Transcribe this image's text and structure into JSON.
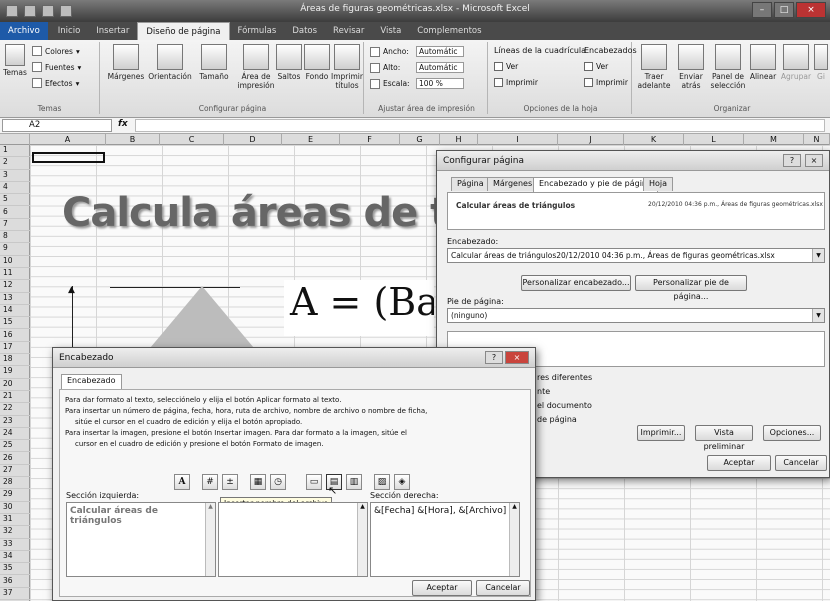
{
  "window": {
    "title": "Áreas de figuras geométricas.xlsx - Microsoft Excel"
  },
  "tabs": [
    "Archivo",
    "Inicio",
    "Insertar",
    "Diseño de página",
    "Fórmulas",
    "Datos",
    "Revisar",
    "Vista",
    "Complementos"
  ],
  "ribbon": {
    "temas": {
      "big": "Temas",
      "colores": "Colores",
      "fuentes": "Fuentes",
      "efectos": "Efectos",
      "label": "Temas"
    },
    "config": {
      "margenes": "Márgenes",
      "orientacion": "Orientación",
      "tamano": "Tamaño",
      "area": "Área de impresión",
      "saltos": "Saltos",
      "fondo": "Fondo",
      "imprimir_titulos": "Imprimir títulos",
      "label": "Configurar página"
    },
    "ajustar": {
      "ancho": "Ancho:",
      "ancho_val": "Automátic",
      "alto": "Alto:",
      "alto_val": "Automátic",
      "escala": "Escala:",
      "escala_val": "100 %",
      "label": "Ajustar área de impresión"
    },
    "opciones": {
      "lineas": "Líneas de la cuadrícula",
      "encabezados": "Encabezados",
      "ver": "Ver",
      "imprimir": "Imprimir",
      "label": "Opciones de la hoja"
    },
    "organizar": {
      "traer": "Traer adelante",
      "enviar": "Enviar atrás",
      "panel": "Panel de selección",
      "alinear": "Alinear",
      "agrupar": "Agrupar",
      "girar": "Gi",
      "label": "Organizar"
    }
  },
  "formula_bar": {
    "cell": "A2",
    "fx": "fx",
    "value": ""
  },
  "columns": [
    "A",
    "B",
    "C",
    "D",
    "E",
    "F",
    "G",
    "H",
    "I",
    "J",
    "K",
    "L",
    "M",
    "N"
  ],
  "rows": [
    "1",
    "2",
    "3",
    "4",
    "5",
    "6",
    "7",
    "8",
    "9",
    "10",
    "11",
    "12",
    "13",
    "14",
    "15",
    "16",
    "17",
    "18",
    "19",
    "20",
    "21",
    "22",
    "23",
    "24",
    "25",
    "26",
    "27",
    "28",
    "29",
    "30",
    "31",
    "32",
    "33",
    "34",
    "35",
    "36",
    "37"
  ],
  "sheet": {
    "title": "Calcula áreas de tri",
    "formula": "A = (Base"
  },
  "config_dialog": {
    "title": "Configurar página",
    "tabs": [
      "Página",
      "Márgenes",
      "Encabezado y pie de página",
      "Hoja"
    ],
    "preview_left": "Calcular áreas de triángulos",
    "preview_right": "20/12/2010 04:36 p.m., Áreas de figuras geométricas.xlsx",
    "header_label": "Encabezado:",
    "header_value": "Calcular áreas de triángulos20/12/2010 04:36 p.m., Áreas de figuras geométricas.xlsx",
    "custom_header": "Personalizar encabezado...",
    "custom_footer": "Personalizar pie de página...",
    "footer_label": "Pie de página:",
    "footer_value": "(ninguno)",
    "opt1": "res diferentes",
    "opt2": "nte",
    "opt3": "el documento",
    "opt4": "de página",
    "print": "Imprimir...",
    "preview": "Vista preliminar",
    "options": "Opciones...",
    "ok": "Aceptar",
    "cancel": "Cancelar"
  },
  "header_dialog": {
    "title": "Encabezado",
    "tab": "Encabezado",
    "instructions": [
      "Para dar formato al texto, selecciónelo y elija el botón Aplicar formato al texto.",
      "Para insertar un número de página, fecha, hora, ruta de archivo, nombre de archivo o nombre de ficha,",
      "sitúe el cursor en el cuadro de edición y elija el botón apropiado.",
      "Para insertar la imagen, presione el botón Insertar imagen. Para dar formato a la imagen, sitúe el",
      "cursor en el cuadro de edición y presione el botón Formato de imagen."
    ],
    "tooltip": "Insertar nombre del archivo",
    "left_label": "Sección izquierda:",
    "center_label": "Sección central:",
    "right_label": "Sección derecha:",
    "left_value": "Calcular áreas de triángulos",
    "center_value": "",
    "right_value": "&[Fecha] &[Hora], &[Archivo]",
    "ok": "Aceptar",
    "cancel": "Cancelar"
  }
}
